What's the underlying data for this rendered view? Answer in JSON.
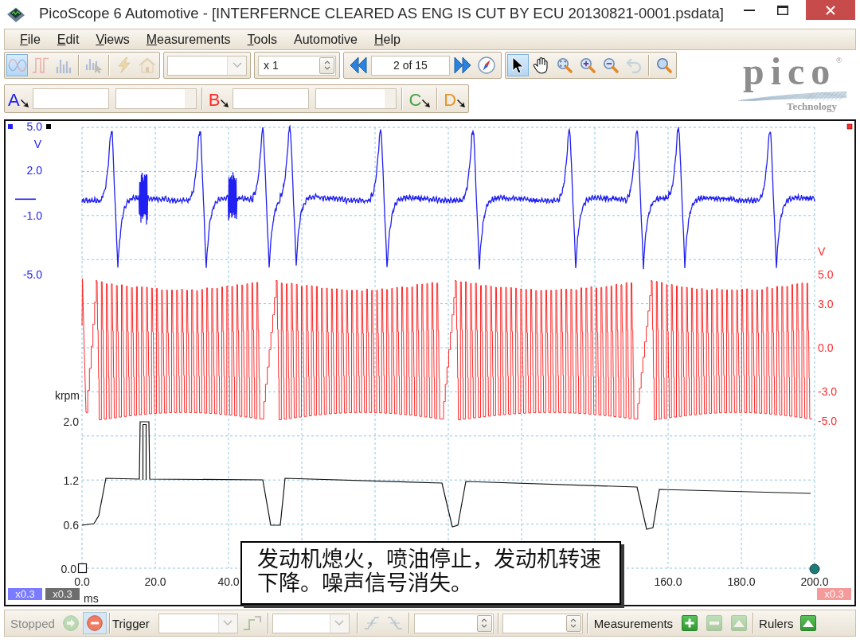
{
  "window": {
    "title": "PicoScope 6 Automotive - [INTERFERNCE CLEARED AS ENG IS CUT BY ECU 20130821-0001.psdata]"
  },
  "menu": [
    {
      "label": "File",
      "accelerator": true
    },
    {
      "label": "Edit",
      "accelerator": true
    },
    {
      "label": "Views",
      "accelerator": true
    },
    {
      "label": "Measurements",
      "accelerator": true
    },
    {
      "label": "Tools",
      "accelerator": true
    },
    {
      "label": "Automotive",
      "accelerator": false
    },
    {
      "label": "Help",
      "accelerator": true
    }
  ],
  "toolbar": {
    "view_buttons": [
      {
        "kind": "sine",
        "selected": true,
        "disabled": true
      },
      {
        "kind": "pulse",
        "selected": false,
        "disabled": true
      },
      {
        "kind": "bars",
        "selected": false,
        "disabled": true
      },
      {
        "kind": "bars-cursor",
        "selected": false,
        "disabled": true
      },
      {
        "kind": "lightning",
        "selected": false,
        "disabled": true
      },
      {
        "kind": "home",
        "selected": false,
        "disabled": true
      }
    ],
    "zoom": "x 1",
    "page": "2 of 15",
    "tools": [
      {
        "kind": "pointer",
        "selected": true,
        "disabled": false
      },
      {
        "kind": "hand",
        "selected": false,
        "disabled": false
      },
      {
        "kind": "zoom-fit",
        "selected": false,
        "disabled": false
      },
      {
        "kind": "zoom-in",
        "selected": false,
        "disabled": false
      },
      {
        "kind": "zoom-out",
        "selected": false,
        "disabled": false
      },
      {
        "kind": "undo",
        "selected": false,
        "disabled": true
      },
      {
        "kind": "zoom-100",
        "selected": false,
        "disabled": false
      }
    ]
  },
  "logo": {
    "wordmark": "pico",
    "mark": "®",
    "tagline": "Technology"
  },
  "channels": [
    {
      "label": "A",
      "color": "#2020f0",
      "kind": "expanded"
    },
    {
      "label": "B",
      "color": "#ff2a2a",
      "kind": "expanded"
    },
    {
      "label": "C",
      "color": "#46a046",
      "kind": "collapsed"
    },
    {
      "label": "D",
      "color": "#e0962a",
      "kind": "collapsed"
    }
  ],
  "scope": {
    "axis_a": {
      "unit": "V",
      "ticks": [
        "5.0",
        "2.0",
        "-1.0",
        "-5.0"
      ]
    },
    "axis_b": {
      "unit": "V",
      "ticks": [
        "5.0",
        "3.0",
        "0.0",
        "-3.0",
        "-5.0"
      ]
    },
    "axis_rpm": {
      "unit": "krpm",
      "ticks": [
        "2.0",
        "1.2",
        "0.6",
        "0.0"
      ]
    },
    "time_axis": {
      "unit": "ms",
      "ticks": [
        "0.0",
        "20.0",
        "40.0",
        "160.0",
        "180.0",
        "200.0"
      ]
    },
    "badges": [
      {
        "label": "x0.3",
        "color": "#7b7bff"
      },
      {
        "label": "x0.3",
        "color": "#6e6e6e"
      },
      {
        "label": "x0.3",
        "color": "#f49a9a"
      }
    ],
    "note": "发动机熄火，喷油停止，发动机转速下降。噪声信号消失。"
  },
  "status_bar": {
    "run_state": "Stopped",
    "run_buttons": [
      {
        "kind": "start",
        "selected": false,
        "disabled": true
      },
      {
        "kind": "stop",
        "selected": true,
        "disabled": false
      }
    ],
    "trigger_label": "Trigger",
    "trigger_buttons": [
      {
        "kind": "step",
        "disabled": true
      },
      {
        "kind": "rising",
        "disabled": true
      },
      {
        "kind": "falling",
        "disabled": true
      }
    ],
    "measurements_label": "Measurements",
    "measurement_buttons": [
      {
        "kind": "plus",
        "disabled": false
      },
      {
        "kind": "minus",
        "disabled": true
      },
      {
        "kind": "triangle",
        "disabled": true
      }
    ],
    "rulers_label": "Rulers",
    "ruler_buttons": [
      {
        "kind": "triangle",
        "disabled": false
      }
    ]
  }
}
